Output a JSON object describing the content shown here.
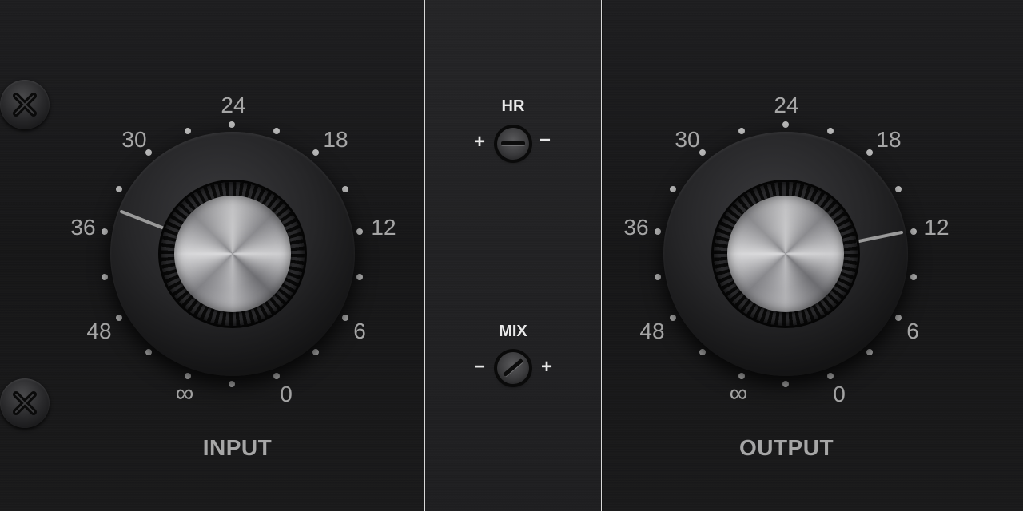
{
  "input": {
    "label": "INPUT",
    "scale_labels": [
      "24",
      "18",
      "12",
      "6",
      "0",
      "∞",
      "48",
      "36",
      "30"
    ],
    "value": "36"
  },
  "output": {
    "label": "OUTPUT",
    "scale_labels": [
      "24",
      "18",
      "12",
      "6",
      "0",
      "∞",
      "48",
      "36",
      "30"
    ],
    "value": "12"
  },
  "hr_trim": {
    "label": "HR",
    "left_sign": "+",
    "right_sign": "−"
  },
  "mix_trim": {
    "label": "MIX",
    "left_sign": "−",
    "right_sign": "+"
  },
  "colors": {
    "panel": "#1a1a1b",
    "scale_text": "#a6a6a6",
    "divider": "#d8d8d8",
    "trim_text": "#e9e9e9"
  }
}
